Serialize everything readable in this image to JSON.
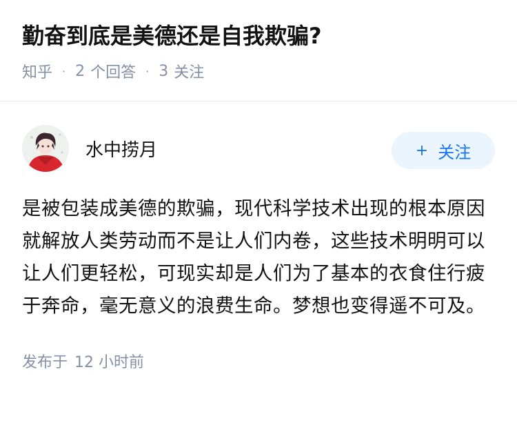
{
  "question": {
    "title": "勤奋到底是美德还是自我欺骗?",
    "source": "知乎",
    "answers_count": "2",
    "answers_label": "个回答",
    "followers_count": "3",
    "followers_label": "关注"
  },
  "answer": {
    "author_name": "水中捞月",
    "follow_button": "关注",
    "follow_icon": "plus-icon",
    "content": "是被包装成美德的欺骗，现代科学技术出现的根本原因就解放人类劳动而不是让人们内卷，这些技术明明可以让人们更轻松，可现实却是人们为了基本的衣食住行疲于奔命，毫无意义的浪费生命。梦想也变得遥不可及。",
    "published_label": "发布于",
    "published_time": "12 小时前"
  },
  "colors": {
    "accent": "#1772f6",
    "follow_bg": "#ebf5fd",
    "meta_gray": "#8590a6",
    "text": "#121212"
  }
}
